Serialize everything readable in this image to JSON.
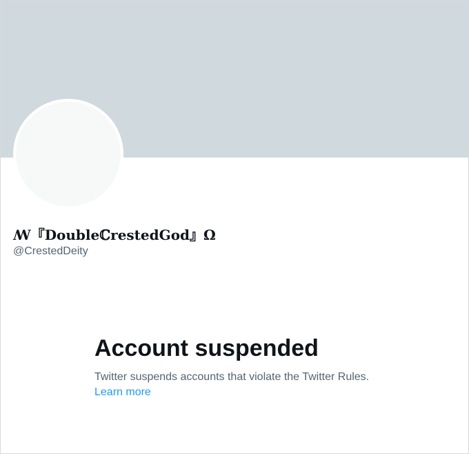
{
  "profile": {
    "display_name": "ꟿ『𝐃𝐨𝐮𝐛𝐥𝐞ℂ𝐫𝐞𝐬𝐭𝐞𝐝𝐆𝐨𝐝』Ω",
    "handle": "@CrestedDeity"
  },
  "suspension": {
    "title": "Account suspended",
    "message": "Twitter suspends accounts that violate the Twitter Rules.",
    "link_label": "Learn more"
  },
  "colors": {
    "banner": "#cfd9de",
    "avatar": "#f7f9f9",
    "link": "#1d9bf0",
    "secondary_text": "#536471",
    "primary_text": "#0f1419"
  }
}
